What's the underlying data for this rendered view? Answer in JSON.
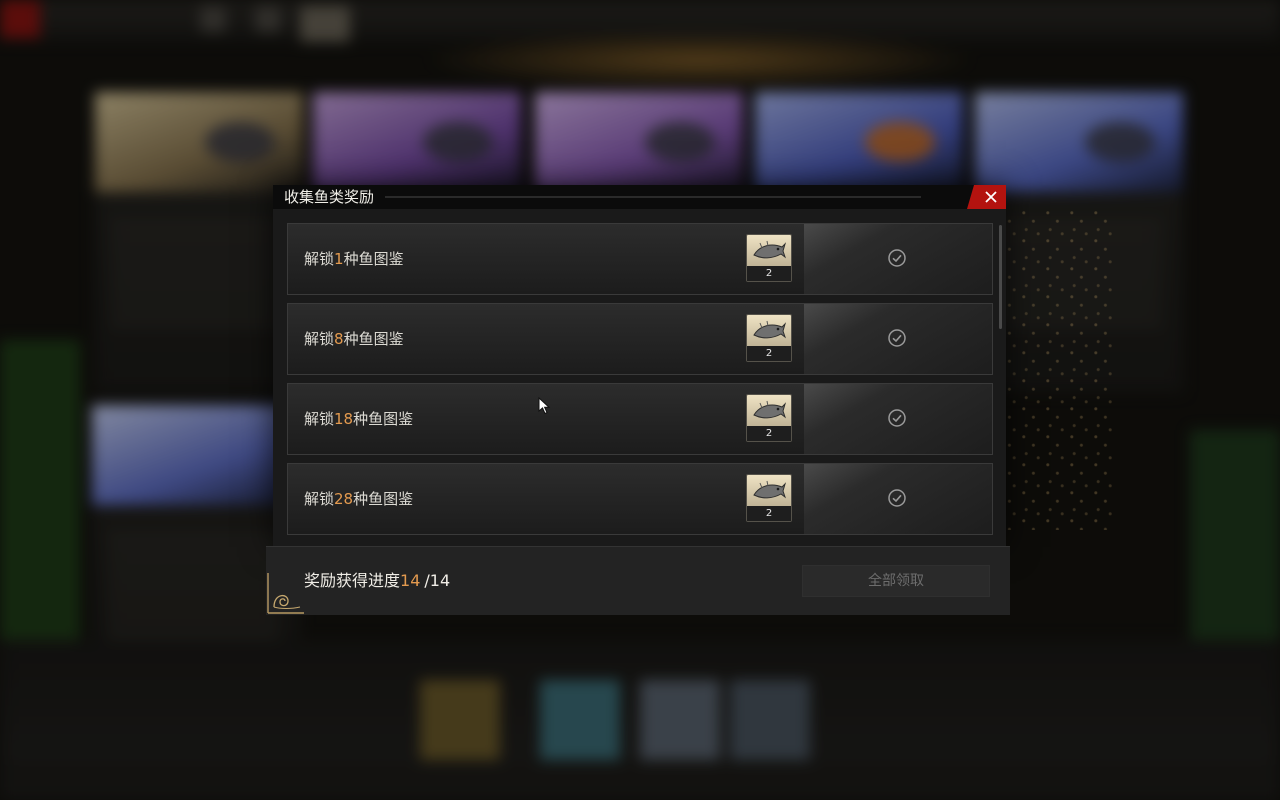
{
  "dialog": {
    "title": "收集鱼类奖励",
    "rows": [
      {
        "prefix": "解锁",
        "count": "1",
        "suffix": "种鱼图鉴",
        "reward_qty": "2"
      },
      {
        "prefix": "解锁",
        "count": "8",
        "suffix": "种鱼图鉴",
        "reward_qty": "2"
      },
      {
        "prefix": "解锁",
        "count": "18",
        "suffix": "种鱼图鉴",
        "reward_qty": "2"
      },
      {
        "prefix": "解锁",
        "count": "28",
        "suffix": "种鱼图鉴",
        "reward_qty": "2"
      }
    ]
  },
  "footer": {
    "progress_label": "奖励获得进度",
    "progress_current": "14",
    "progress_total": "/14",
    "claim_all_label": "全部领取"
  },
  "colors": {
    "accent_orange": "#e39a4f",
    "close_red": "#b3130f"
  }
}
